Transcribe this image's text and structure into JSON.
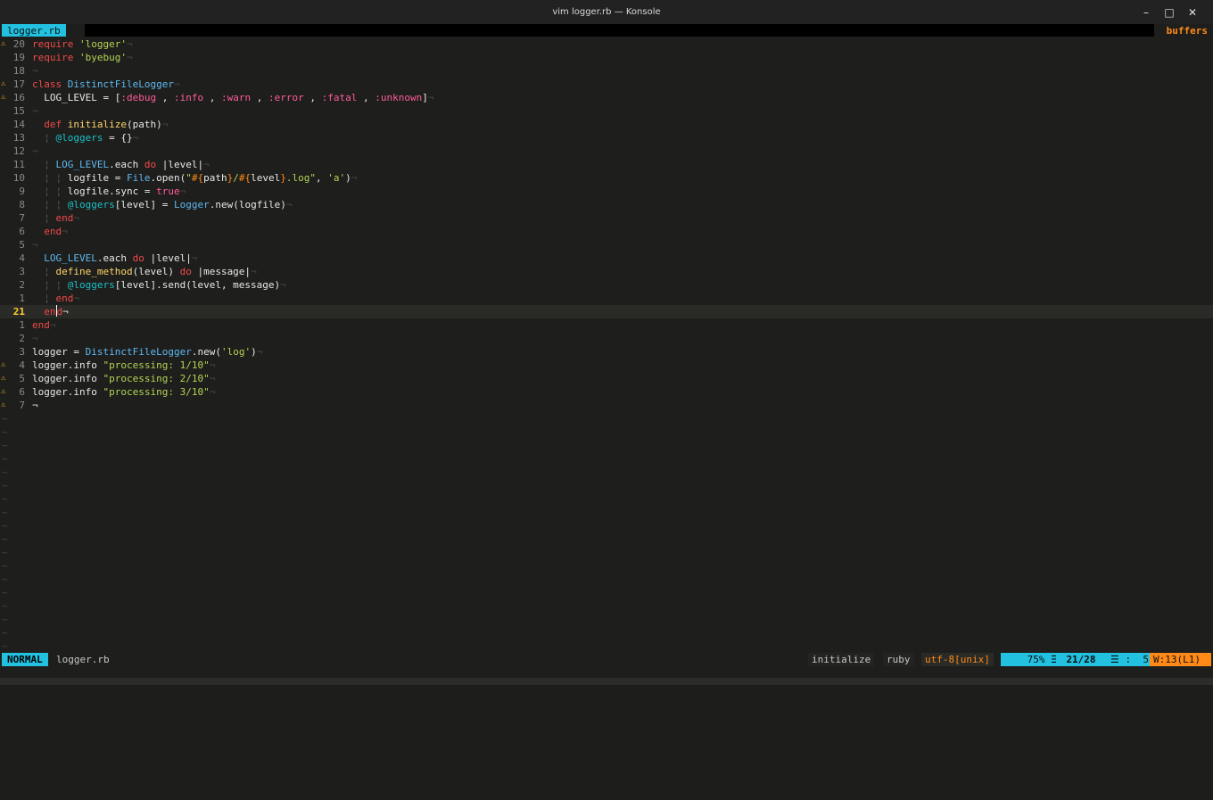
{
  "window": {
    "title": "vim logger.rb — Konsole"
  },
  "window_controls": {
    "minimize": "–",
    "maximize": "□",
    "close": "✕"
  },
  "tabline": {
    "active_tab": "logger.rb",
    "right_label": "buffers"
  },
  "status": {
    "mode": "NORMAL",
    "file": "logger.rb",
    "function": "initialize",
    "filetype": "ruby",
    "encoding": "utf-8[unix]",
    "percent": "75% ☰",
    "position": "21/28",
    "column": "☰ :  5",
    "warnings": "W:13(L1)"
  },
  "lines": [
    {
      "num": "20",
      "sign": "⚠",
      "tokens": [
        [
          "k",
          "require"
        ],
        [
          "o",
          " "
        ],
        [
          "s",
          "'logger'"
        ],
        [
          "eol",
          "¬"
        ]
      ]
    },
    {
      "num": "19",
      "sign": "",
      "tokens": [
        [
          "k",
          "require"
        ],
        [
          "o",
          " "
        ],
        [
          "s",
          "'byebug'"
        ],
        [
          "eol",
          "¬"
        ]
      ]
    },
    {
      "num": "18",
      "sign": "",
      "tokens": [
        [
          "eol",
          "¬"
        ]
      ]
    },
    {
      "num": "17",
      "sign": "⚠",
      "tokens": [
        [
          "k",
          "class"
        ],
        [
          "o",
          " "
        ],
        [
          "c",
          "DistinctFileLogger"
        ],
        [
          "eol",
          "¬"
        ]
      ]
    },
    {
      "num": "16",
      "sign": "⚠",
      "tokens": [
        [
          "o",
          "  LOG_LEVEL = ["
        ],
        [
          "y",
          ":debug"
        ],
        [
          "o",
          " , "
        ],
        [
          "y",
          ":info"
        ],
        [
          "o",
          " , "
        ],
        [
          "y",
          ":warn"
        ],
        [
          "o",
          " , "
        ],
        [
          "y",
          ":error"
        ],
        [
          "o",
          " , "
        ],
        [
          "y",
          ":fatal"
        ],
        [
          "o",
          " , "
        ],
        [
          "y",
          ":unknown"
        ],
        [
          "o",
          "]"
        ],
        [
          "eol",
          "¬"
        ]
      ]
    },
    {
      "num": "15",
      "sign": "",
      "tokens": [
        [
          "eol",
          "¬"
        ]
      ]
    },
    {
      "num": "14",
      "sign": "",
      "tokens": [
        [
          "o",
          "  "
        ],
        [
          "k",
          "def"
        ],
        [
          "o",
          " "
        ],
        [
          "f",
          "initialize"
        ],
        [
          "o",
          "(path)"
        ],
        [
          "eol",
          "¬"
        ]
      ]
    },
    {
      "num": "13",
      "sign": "",
      "tokens": [
        [
          "o",
          "  "
        ],
        [
          "g",
          "¦"
        ],
        [
          "o",
          " "
        ],
        [
          "v",
          "@loggers"
        ],
        [
          "o",
          " = {}"
        ],
        [
          "eol",
          "¬"
        ]
      ]
    },
    {
      "num": "12",
      "sign": "",
      "tokens": [
        [
          "eol",
          "¬"
        ]
      ]
    },
    {
      "num": "11",
      "sign": "",
      "tokens": [
        [
          "o",
          "  "
        ],
        [
          "g",
          "¦"
        ],
        [
          "o",
          " "
        ],
        [
          "c",
          "LOG_LEVEL"
        ],
        [
          "o",
          ".each "
        ],
        [
          "k",
          "do"
        ],
        [
          "o",
          " |level|"
        ],
        [
          "eol",
          "¬"
        ]
      ]
    },
    {
      "num": "10",
      "sign": "",
      "tokens": [
        [
          "o",
          "  "
        ],
        [
          "g",
          "¦ ¦"
        ],
        [
          "o",
          " logfile = "
        ],
        [
          "c",
          "File"
        ],
        [
          "o",
          ".open("
        ],
        [
          "s",
          "\""
        ],
        [
          "e",
          "#{"
        ],
        [
          "o",
          "path"
        ],
        [
          "e",
          "}"
        ],
        [
          "s",
          "/"
        ],
        [
          "e",
          "#{"
        ],
        [
          "o",
          "level"
        ],
        [
          "e",
          "}"
        ],
        [
          "s",
          ".log\""
        ],
        [
          "o",
          ", "
        ],
        [
          "s",
          "'a'"
        ],
        [
          "o",
          ")"
        ],
        [
          "eol",
          "¬"
        ]
      ]
    },
    {
      "num": "9",
      "sign": "",
      "tokens": [
        [
          "o",
          "  "
        ],
        [
          "g",
          "¦ ¦"
        ],
        [
          "o",
          " logfile.sync = "
        ],
        [
          "b",
          "true"
        ],
        [
          "eol",
          "¬"
        ]
      ]
    },
    {
      "num": "8",
      "sign": "",
      "tokens": [
        [
          "o",
          "  "
        ],
        [
          "g",
          "¦ ¦"
        ],
        [
          "o",
          " "
        ],
        [
          "v",
          "@loggers"
        ],
        [
          "o",
          "[level] = "
        ],
        [
          "c",
          "Logger"
        ],
        [
          "o",
          ".new(logfile)"
        ],
        [
          "eol",
          "¬"
        ]
      ]
    },
    {
      "num": "7",
      "sign": "",
      "tokens": [
        [
          "o",
          "  "
        ],
        [
          "g",
          "¦"
        ],
        [
          "o",
          " "
        ],
        [
          "k",
          "end"
        ],
        [
          "eol",
          "¬"
        ]
      ]
    },
    {
      "num": "6",
      "sign": "",
      "tokens": [
        [
          "o",
          "  "
        ],
        [
          "k",
          "end"
        ],
        [
          "eol",
          "¬"
        ]
      ]
    },
    {
      "num": "5",
      "sign": "",
      "tokens": [
        [
          "eol",
          "¬"
        ]
      ]
    },
    {
      "num": "4",
      "sign": "",
      "tokens": [
        [
          "o",
          "  "
        ],
        [
          "c",
          "LOG_LEVEL"
        ],
        [
          "o",
          ".each "
        ],
        [
          "k",
          "do"
        ],
        [
          "o",
          " |level|"
        ],
        [
          "eol",
          "¬"
        ]
      ]
    },
    {
      "num": "3",
      "sign": "",
      "tokens": [
        [
          "o",
          "  "
        ],
        [
          "g",
          "¦"
        ],
        [
          "o",
          " "
        ],
        [
          "f",
          "define_method"
        ],
        [
          "o",
          "(level) "
        ],
        [
          "k",
          "do"
        ],
        [
          "o",
          " |message|"
        ],
        [
          "eol",
          "¬"
        ]
      ]
    },
    {
      "num": "2",
      "sign": "",
      "tokens": [
        [
          "o",
          "  "
        ],
        [
          "g",
          "¦ ¦"
        ],
        [
          "o",
          " "
        ],
        [
          "v",
          "@loggers"
        ],
        [
          "o",
          "[level].send(level, message)"
        ],
        [
          "eol",
          "¬"
        ]
      ]
    },
    {
      "num": "1",
      "sign": "",
      "tokens": [
        [
          "o",
          "  "
        ],
        [
          "g",
          "¦"
        ],
        [
          "o",
          " "
        ],
        [
          "k",
          "end"
        ],
        [
          "eol",
          "¬"
        ]
      ]
    },
    {
      "num": "21",
      "sign": "",
      "current": true,
      "tokens": [
        [
          "o",
          "  "
        ],
        [
          "k",
          "en"
        ],
        [
          "cursor",
          ""
        ],
        [
          "k",
          "d"
        ],
        [
          "o",
          "¬"
        ]
      ]
    },
    {
      "num": "1",
      "sign": "",
      "tokens": [
        [
          "k",
          "end"
        ],
        [
          "eol",
          "¬"
        ]
      ]
    },
    {
      "num": "2",
      "sign": "",
      "tokens": [
        [
          "eol",
          "¬"
        ]
      ]
    },
    {
      "num": "3",
      "sign": "",
      "tokens": [
        [
          "o",
          "logger = "
        ],
        [
          "c",
          "DistinctFileLogger"
        ],
        [
          "o",
          ".new("
        ],
        [
          "s",
          "'log'"
        ],
        [
          "o",
          ")"
        ],
        [
          "eol",
          "¬"
        ]
      ]
    },
    {
      "num": "4",
      "sign": "⚠",
      "tokens": [
        [
          "o",
          "logger.info "
        ],
        [
          "s",
          "\"processing: 1/10\""
        ],
        [
          "eol",
          "¬"
        ]
      ]
    },
    {
      "num": "5",
      "sign": "⚠",
      "tokens": [
        [
          "o",
          "logger.info "
        ],
        [
          "s",
          "\"processing: 2/10\""
        ],
        [
          "eol",
          "¬"
        ]
      ]
    },
    {
      "num": "6",
      "sign": "⚠",
      "tokens": [
        [
          "o",
          "logger.info "
        ],
        [
          "s",
          "\"processing: 3/10\""
        ],
        [
          "eol",
          "¬"
        ]
      ]
    },
    {
      "num": "7",
      "sign": "⚠",
      "tokens": [
        [
          "o",
          "¬"
        ]
      ]
    }
  ],
  "tilde_char": "~",
  "tilde_count": 18
}
